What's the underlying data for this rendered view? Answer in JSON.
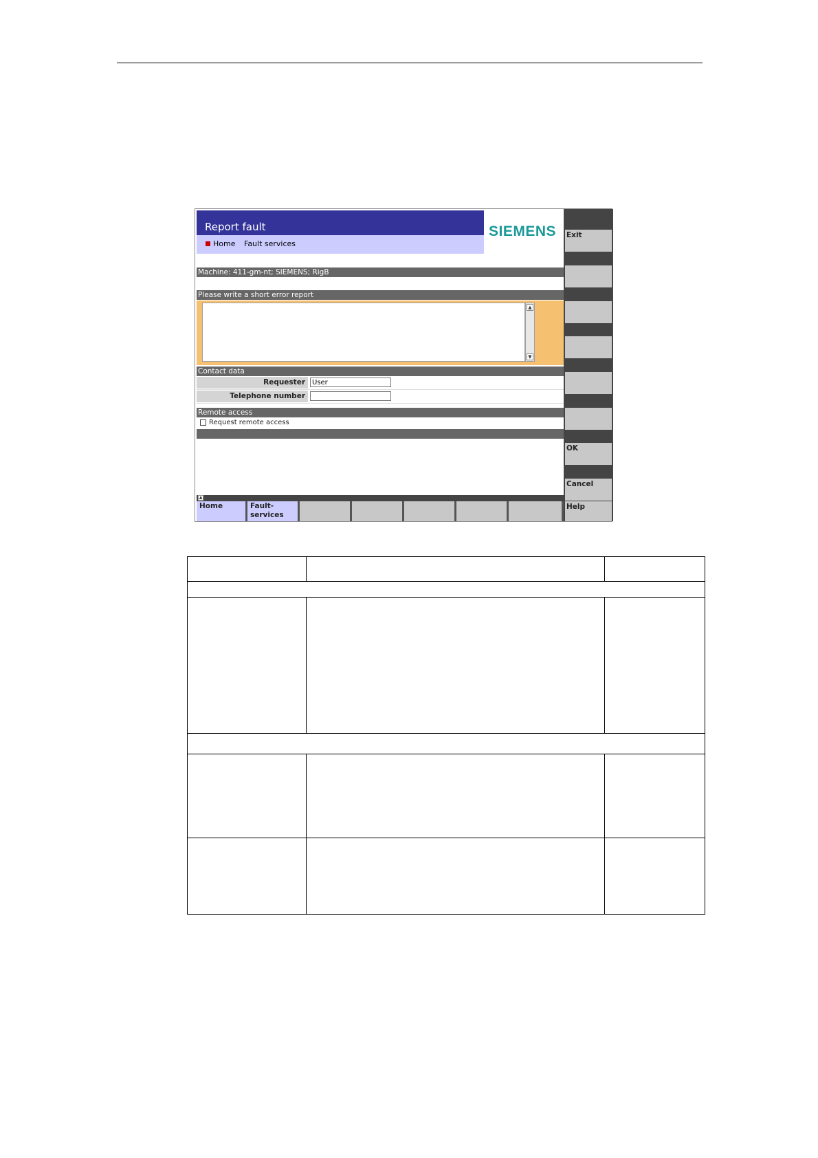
{
  "window": {
    "title": "Report fault",
    "logo": "SIEMENS",
    "colors": {
      "title_bar": "#333399",
      "breadcrumb_bar": "#ccccff",
      "logo": "#1a9999",
      "section_bar": "#666666",
      "report_frame": "#f5c070"
    }
  },
  "breadcrumb": {
    "home": "Home",
    "current": "Fault services"
  },
  "machine": {
    "label": "Machine: 411-gm-nt; SIEMENS; RigB"
  },
  "report": {
    "heading": "Please write a short error report",
    "text": ""
  },
  "contact": {
    "heading": "Contact data",
    "requester_label": "Requester",
    "requester_value": "User",
    "phone_label": "Telephone number",
    "phone_value": ""
  },
  "remote": {
    "heading": "Remote access",
    "checkbox_label": "Request remote access",
    "checked": false
  },
  "vertical_softkeys": {
    "exit": "Exit",
    "ok": "OK",
    "cancel": "Cancel"
  },
  "horizontal_softkeys": {
    "home": "Home",
    "fault_services": "Fault-\nservices",
    "help": "Help"
  },
  "icons": {
    "scroll_up": "scroll-up-icon",
    "scroll_down": "scroll-down-icon",
    "softkey_up": "chevron-up-icon"
  }
}
